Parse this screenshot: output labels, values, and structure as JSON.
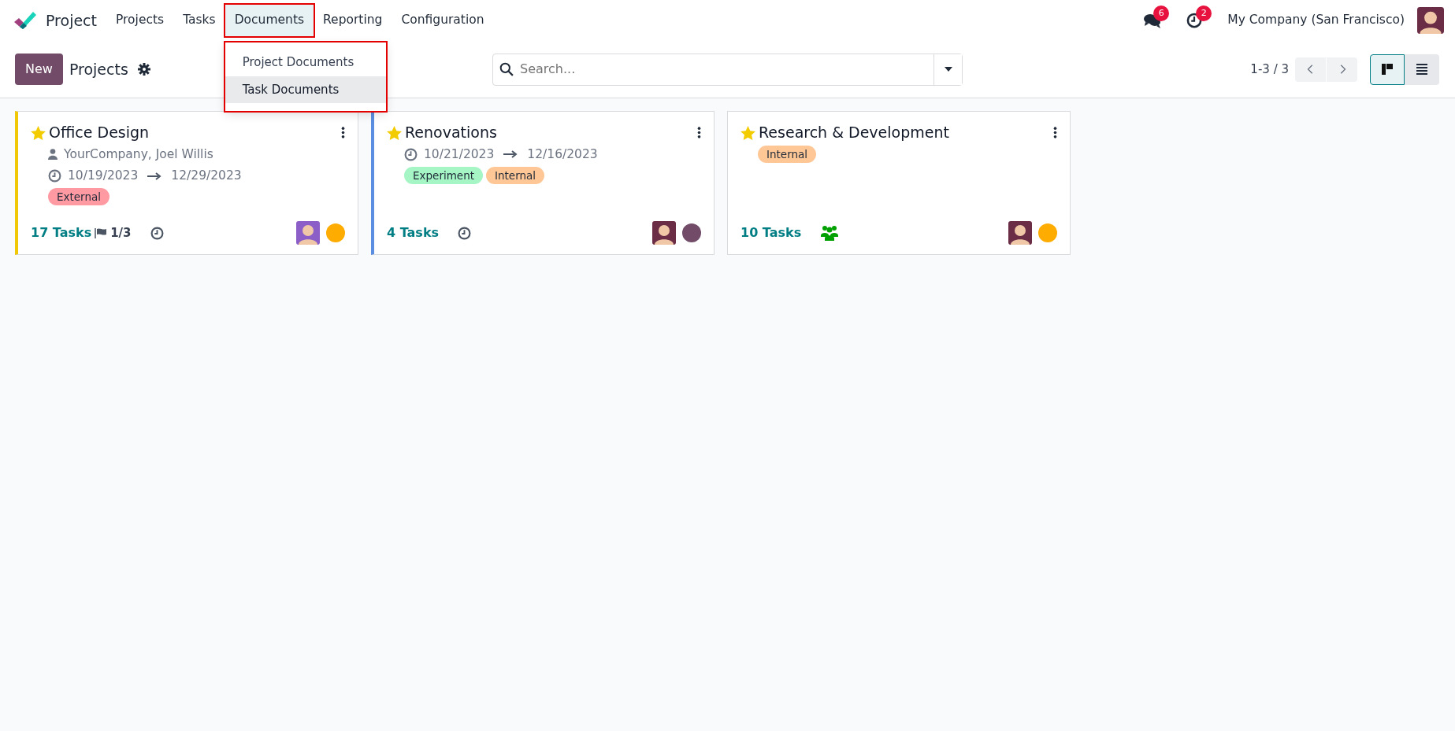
{
  "app": {
    "name": "Project"
  },
  "menu": [
    {
      "label": "Projects",
      "selected": false,
      "annotated": false
    },
    {
      "label": "Tasks",
      "selected": false,
      "annotated": false
    },
    {
      "label": "Documents",
      "selected": true,
      "annotated": true
    },
    {
      "label": "Reporting",
      "selected": false,
      "annotated": false
    },
    {
      "label": "Configuration",
      "selected": false,
      "annotated": false
    }
  ],
  "dropdown": {
    "annotated": true,
    "items": [
      {
        "label": "Project Documents",
        "selected": false
      },
      {
        "label": "Task Documents",
        "selected": true
      }
    ]
  },
  "systray": {
    "messages_badge": "6",
    "activities_badge": "2",
    "company": "My Company (San Francisco)"
  },
  "control_panel": {
    "new_button": "New",
    "breadcrumb": "Projects",
    "search": {
      "placeholder": "Search..."
    },
    "pager": "1-3 / 3",
    "views": [
      {
        "kind": "kanban",
        "selected": true
      },
      {
        "kind": "list",
        "selected": false
      }
    ]
  },
  "cards": [
    {
      "title": "Office Design",
      "favorite": true,
      "color": "#f0c808",
      "partner": "YourCompany, Joel Willis",
      "start": "10/19/2023",
      "end": "12/29/2023",
      "tags": [
        {
          "label": "External",
          "color": "#ff9aa2"
        }
      ],
      "tasks": "17 Tasks",
      "milestones": "1/3",
      "footer_icon": {
        "kind": "clock"
      },
      "status": {
        "color": "#ffac00"
      }
    },
    {
      "title": "Renovations",
      "favorite": true,
      "color": "#5b8ee0",
      "start": "10/21/2023",
      "end": "12/16/2023",
      "tags": [
        {
          "label": "Experiment",
          "color": "#a5f5c5"
        },
        {
          "label": "Internal",
          "color": "#ffc796"
        }
      ],
      "tasks": "4 Tasks",
      "footer_icon": {
        "kind": "clock"
      },
      "status": {
        "color": "#714b67"
      }
    },
    {
      "title": "Research & Development",
      "favorite": true,
      "tags": [
        {
          "label": "Internal",
          "color": "#ffc796"
        }
      ],
      "tasks": "10 Tasks",
      "footer_icon": {
        "kind": "people"
      },
      "status": {
        "color": "#ffac00"
      }
    }
  ]
}
